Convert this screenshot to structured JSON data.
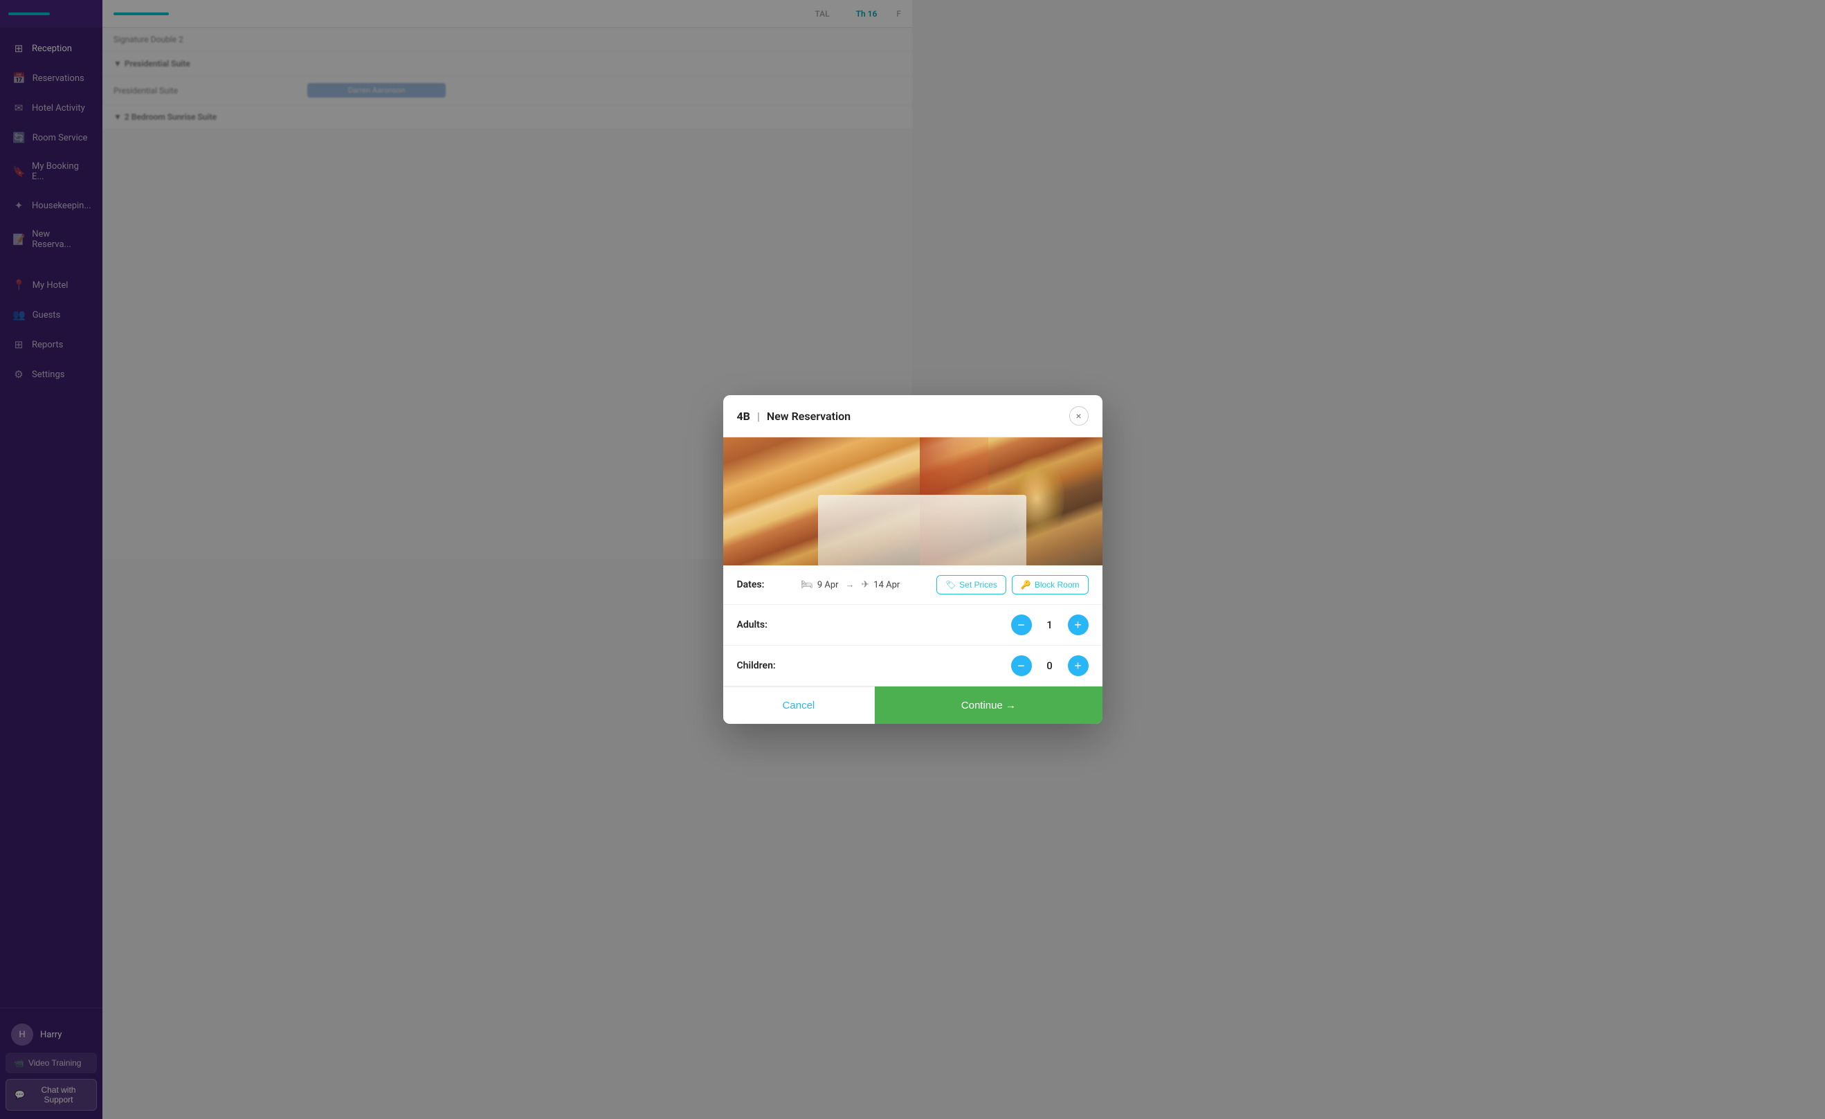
{
  "sidebar": {
    "logo_bar": "",
    "nav_items": [
      {
        "id": "reception",
        "label": "Reception",
        "icon": "⊞",
        "active": true
      },
      {
        "id": "reservations",
        "label": "Reservations",
        "icon": "📅"
      },
      {
        "id": "hotel-activity",
        "label": "Hotel Activity",
        "icon": "✉"
      },
      {
        "id": "room-service",
        "label": "Room Service",
        "icon": "🔄"
      },
      {
        "id": "my-booking",
        "label": "My Booking E...",
        "icon": "🔖"
      },
      {
        "id": "housekeeping",
        "label": "Housekeepin...",
        "icon": "✦"
      },
      {
        "id": "new-reservation",
        "label": "New Reserva...",
        "icon": "📝"
      }
    ],
    "section_items": [
      {
        "id": "my-hotel",
        "label": "My Hotel",
        "icon": "📍"
      },
      {
        "id": "guests",
        "label": "Guests",
        "icon": "👥"
      },
      {
        "id": "reports",
        "label": "Reports",
        "icon": "⊞"
      },
      {
        "id": "settings",
        "label": "Settings",
        "icon": "⚙"
      }
    ],
    "user": {
      "name": "Harry",
      "initials": "H"
    },
    "video_training_label": "Video Training",
    "chat_support_label": "Chat with Support"
  },
  "topbar": {
    "progress_label": ""
  },
  "calendar": {
    "columns": [
      "Th 16",
      "F"
    ],
    "rows": [
      {
        "label": "Signature Double 2",
        "type": "room"
      },
      {
        "label": "Presidential Suite",
        "type": "category"
      },
      {
        "label": "Presidential Suite",
        "type": "room",
        "booking": "Darren Aaronson"
      },
      {
        "label": "2 Bedroom Sunrise Suite",
        "type": "category"
      }
    ]
  },
  "modal": {
    "room_id": "4B",
    "title": "New Reservation",
    "close_label": "×",
    "dates": {
      "label": "Dates:",
      "check_in": "9 Apr",
      "check_out": "14 Apr",
      "arrow": "→",
      "set_prices_label": "Set Prices",
      "block_room_label": "Block Room"
    },
    "adults": {
      "label": "Adults:",
      "value": 1
    },
    "children": {
      "label": "Children:",
      "value": 0
    },
    "cancel_label": "Cancel",
    "continue_label": "Continue →"
  }
}
